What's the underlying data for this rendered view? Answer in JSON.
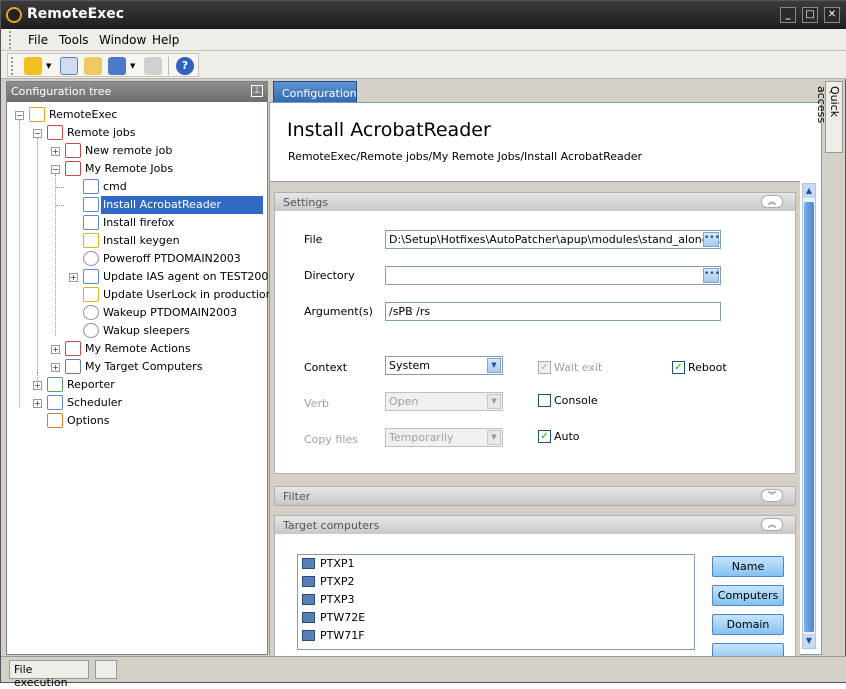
{
  "app": {
    "title": "RemoteExec"
  },
  "menu": [
    {
      "label": "File"
    },
    {
      "label": "Tools"
    },
    {
      "label": "Window"
    },
    {
      "label": "Help"
    }
  ],
  "tree": {
    "header": "Configuration tree",
    "items": [
      {
        "label": "RemoteExec",
        "icon": "remoteexec-icon",
        "color": "#e8a020"
      },
      {
        "label": "Remote jobs",
        "icon": "remote-jobs-icon",
        "color": "#c94a4a"
      },
      {
        "label": "New remote job",
        "icon": "new-job-icon",
        "color": "#c94a4a"
      },
      {
        "label": "My Remote Jobs",
        "icon": "folder-jobs-icon",
        "color": "#c94a4a"
      },
      {
        "label": "cmd",
        "icon": "script-icon",
        "color": "#5a8ad0"
      },
      {
        "label": "Install AcrobatReader",
        "icon": "script-icon",
        "color": "#5a8ad0"
      },
      {
        "label": "Install firefox",
        "icon": "script-icon",
        "color": "#5a8ad0"
      },
      {
        "label": "Install keygen",
        "icon": "install-icon",
        "color": "#e0b020"
      },
      {
        "label": "Poweroff PTDOMAIN2003",
        "icon": "gear-icon",
        "color": "#909090"
      },
      {
        "label": "Update IAS agent on TEST200...",
        "icon": "script-icon",
        "color": "#5a8ad0"
      },
      {
        "label": "Update UserLock in production",
        "icon": "install-icon",
        "color": "#e0b020"
      },
      {
        "label": "Wakeup PTDOMAIN2003",
        "icon": "gear-icon",
        "color": "#909090"
      },
      {
        "label": "Wakup sleepers",
        "icon": "gear-icon",
        "color": "#909090"
      },
      {
        "label": "My Remote Actions",
        "icon": "folder-actions-icon",
        "color": "#c94a4a"
      },
      {
        "label": "My Target Computers",
        "icon": "computers-icon",
        "color": "#5a7fb8"
      },
      {
        "label": "Reporter",
        "icon": "reporter-icon",
        "color": "#60a060"
      },
      {
        "label": "Scheduler",
        "icon": "scheduler-icon",
        "color": "#5a8ad0"
      },
      {
        "label": "Options",
        "icon": "wrench-icon",
        "color": "#d08030"
      }
    ]
  },
  "tab": {
    "label": "Configuration"
  },
  "page": {
    "title": "Install AcrobatReader",
    "breadcrumb": "RemoteExec/Remote jobs/My Remote Jobs/Install AcrobatReader"
  },
  "settings": {
    "header": "Settings",
    "file_label": "File",
    "file_value": "D:\\Setup\\Hotfixes\\AutoPatcher\\apup\\modules\\stand_alone\\Adbe",
    "directory_label": "Directory",
    "directory_value": "",
    "arguments_label": "Argument(s)",
    "arguments_value": "/sPB /rs",
    "context_label": "Context",
    "context_value": "System",
    "verb_label": "Verb",
    "verb_value": "Open",
    "copy_label": "Copy files",
    "copy_value": "Temporarily",
    "wait_exit": "Wait exit",
    "reboot": "Reboot",
    "console": "Console",
    "auto": "Auto"
  },
  "filter": {
    "header": "Filter"
  },
  "targets": {
    "header": "Target computers",
    "computers": [
      "PTXP1",
      "PTXP2",
      "PTXP3",
      "PTW72E",
      "PTW71F"
    ],
    "buttons": [
      "Name",
      "Computers",
      "Domain"
    ]
  },
  "quick_access": "Quick access",
  "status": {
    "text": "File execution"
  }
}
